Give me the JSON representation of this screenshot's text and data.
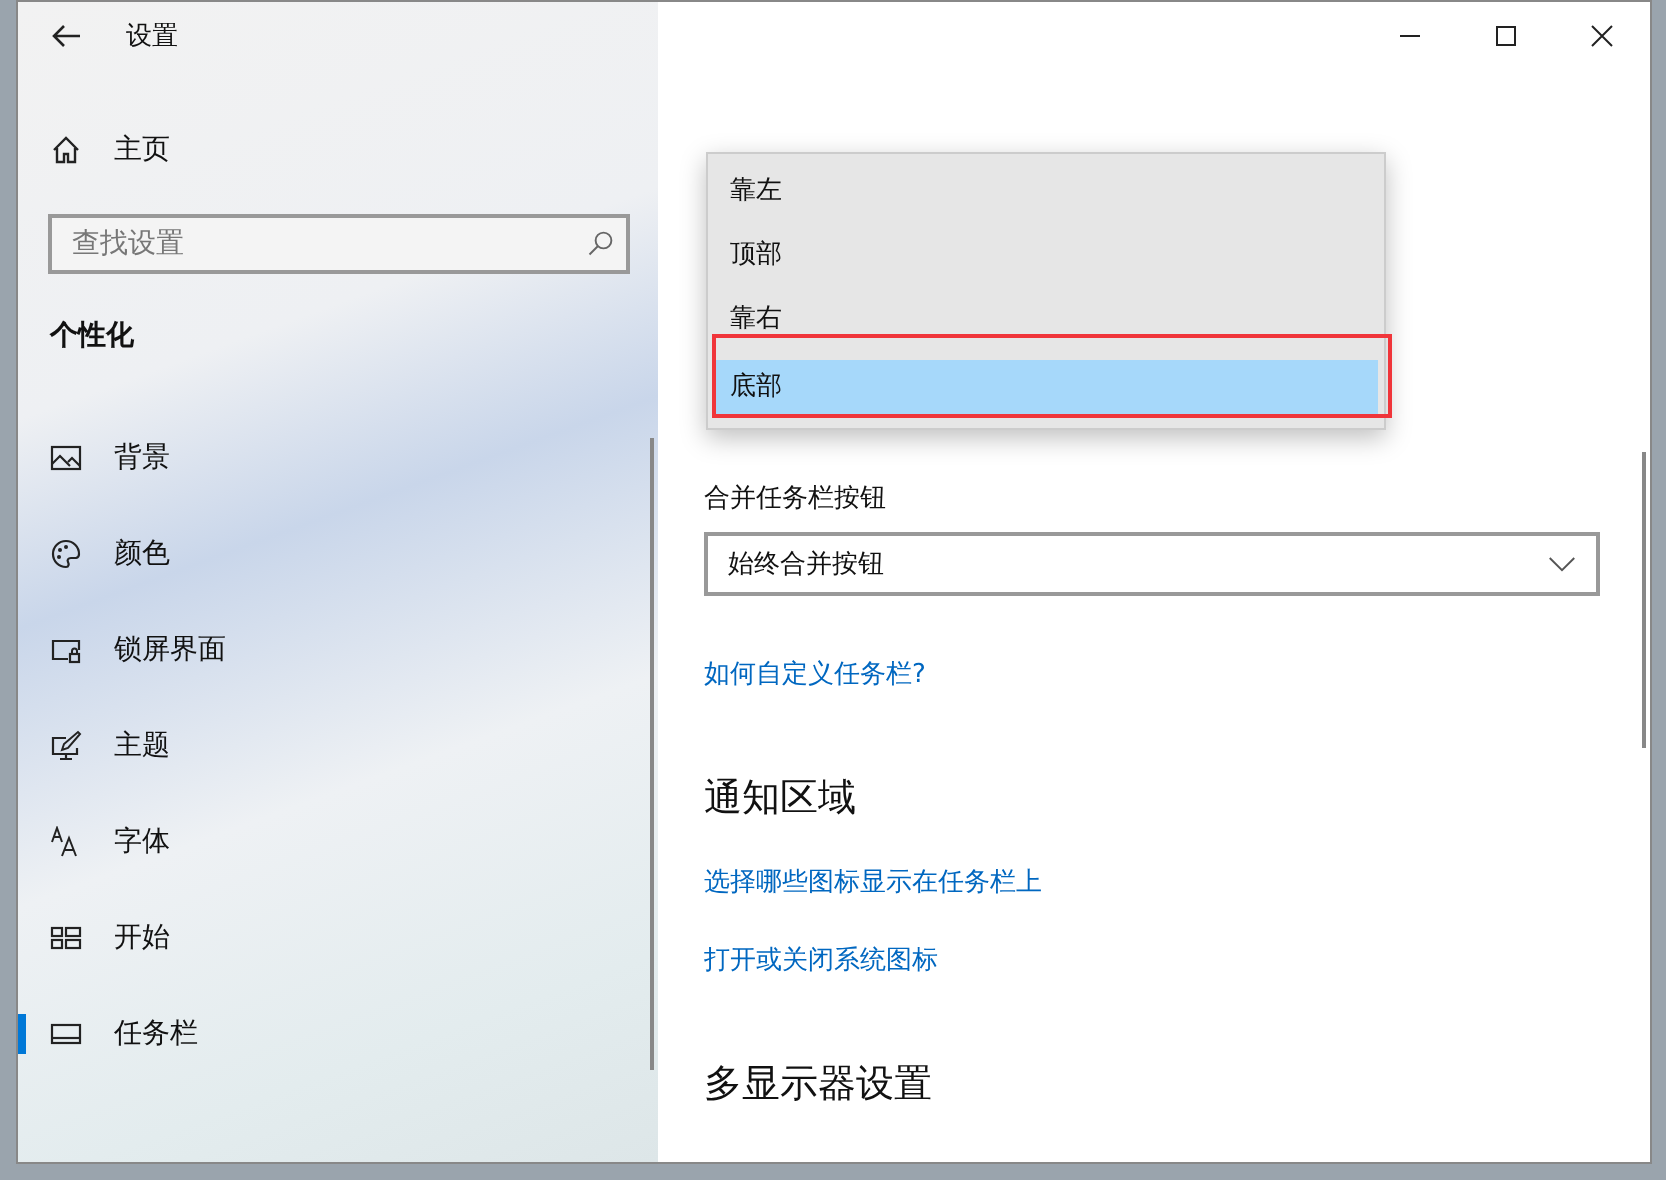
{
  "window": {
    "title": "设置"
  },
  "sidebar": {
    "home": "主页",
    "search": {
      "placeholder": "查找设置"
    },
    "section": "个性化",
    "items": [
      {
        "label": "背景",
        "kind": "picture",
        "selected": false
      },
      {
        "label": "颜色",
        "kind": "palette",
        "selected": false
      },
      {
        "label": "锁屏界面",
        "kind": "lock",
        "selected": false
      },
      {
        "label": "主题",
        "kind": "theme",
        "selected": false
      },
      {
        "label": "字体",
        "kind": "font",
        "selected": false
      },
      {
        "label": "开始",
        "kind": "start",
        "selected": false
      },
      {
        "label": "任务栏",
        "kind": "taskbar",
        "selected": true
      }
    ]
  },
  "content": {
    "position_dropdown": {
      "options": [
        {
          "label": "靠左",
          "selected": false
        },
        {
          "label": "顶部",
          "selected": false
        },
        {
          "label": "靠右",
          "selected": false
        },
        {
          "label": "底部",
          "selected": true
        }
      ],
      "highlighted": true
    },
    "combine_label": "合并任务栏按钮",
    "combine_value": "始终合并按钮",
    "help_link": "如何自定义任务栏?",
    "notification": {
      "heading": "通知区域",
      "links": [
        "选择哪些图标显示在任务栏上",
        "打开或关闭系统图标"
      ]
    },
    "multi_display": {
      "heading": "多显示器设置"
    }
  }
}
